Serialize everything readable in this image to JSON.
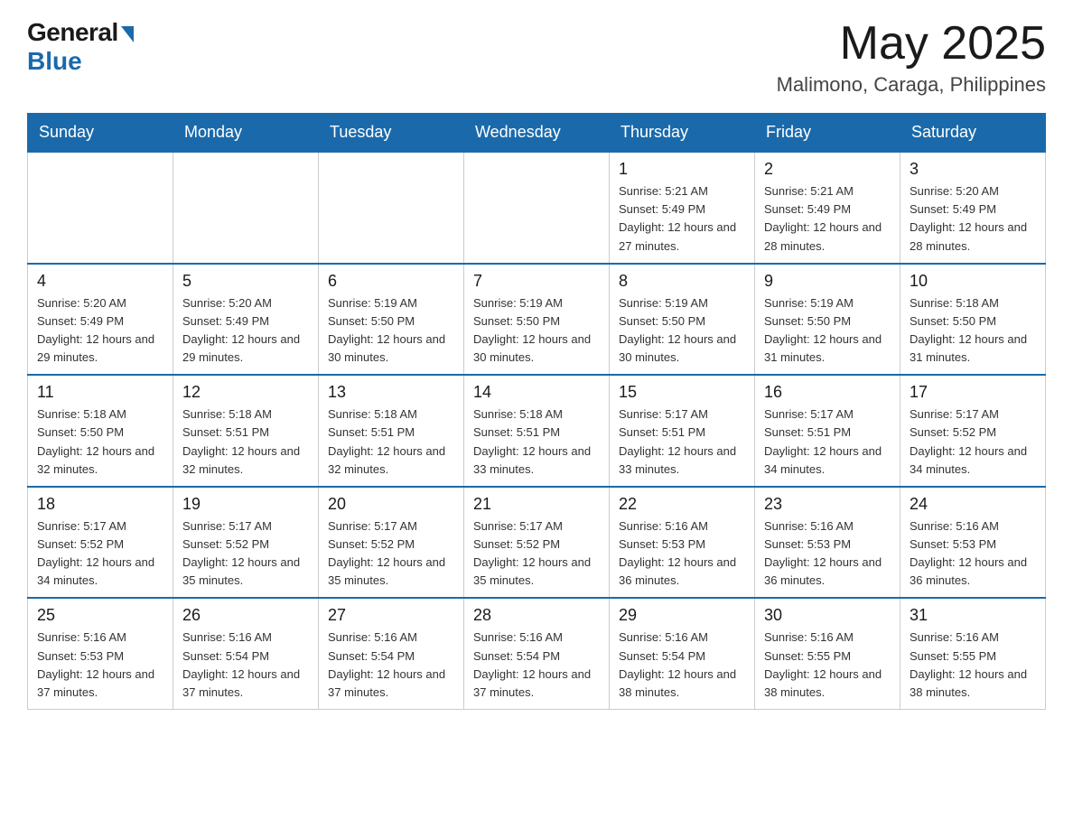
{
  "header": {
    "logo_general": "General",
    "logo_blue": "Blue",
    "month_title": "May 2025",
    "location": "Malimono, Caraga, Philippines"
  },
  "days_of_week": [
    "Sunday",
    "Monday",
    "Tuesday",
    "Wednesday",
    "Thursday",
    "Friday",
    "Saturday"
  ],
  "weeks": [
    [
      {
        "day": "",
        "info": ""
      },
      {
        "day": "",
        "info": ""
      },
      {
        "day": "",
        "info": ""
      },
      {
        "day": "",
        "info": ""
      },
      {
        "day": "1",
        "info": "Sunrise: 5:21 AM\nSunset: 5:49 PM\nDaylight: 12 hours and 27 minutes."
      },
      {
        "day": "2",
        "info": "Sunrise: 5:21 AM\nSunset: 5:49 PM\nDaylight: 12 hours and 28 minutes."
      },
      {
        "day": "3",
        "info": "Sunrise: 5:20 AM\nSunset: 5:49 PM\nDaylight: 12 hours and 28 minutes."
      }
    ],
    [
      {
        "day": "4",
        "info": "Sunrise: 5:20 AM\nSunset: 5:49 PM\nDaylight: 12 hours and 29 minutes."
      },
      {
        "day": "5",
        "info": "Sunrise: 5:20 AM\nSunset: 5:49 PM\nDaylight: 12 hours and 29 minutes."
      },
      {
        "day": "6",
        "info": "Sunrise: 5:19 AM\nSunset: 5:50 PM\nDaylight: 12 hours and 30 minutes."
      },
      {
        "day": "7",
        "info": "Sunrise: 5:19 AM\nSunset: 5:50 PM\nDaylight: 12 hours and 30 minutes."
      },
      {
        "day": "8",
        "info": "Sunrise: 5:19 AM\nSunset: 5:50 PM\nDaylight: 12 hours and 30 minutes."
      },
      {
        "day": "9",
        "info": "Sunrise: 5:19 AM\nSunset: 5:50 PM\nDaylight: 12 hours and 31 minutes."
      },
      {
        "day": "10",
        "info": "Sunrise: 5:18 AM\nSunset: 5:50 PM\nDaylight: 12 hours and 31 minutes."
      }
    ],
    [
      {
        "day": "11",
        "info": "Sunrise: 5:18 AM\nSunset: 5:50 PM\nDaylight: 12 hours and 32 minutes."
      },
      {
        "day": "12",
        "info": "Sunrise: 5:18 AM\nSunset: 5:51 PM\nDaylight: 12 hours and 32 minutes."
      },
      {
        "day": "13",
        "info": "Sunrise: 5:18 AM\nSunset: 5:51 PM\nDaylight: 12 hours and 32 minutes."
      },
      {
        "day": "14",
        "info": "Sunrise: 5:18 AM\nSunset: 5:51 PM\nDaylight: 12 hours and 33 minutes."
      },
      {
        "day": "15",
        "info": "Sunrise: 5:17 AM\nSunset: 5:51 PM\nDaylight: 12 hours and 33 minutes."
      },
      {
        "day": "16",
        "info": "Sunrise: 5:17 AM\nSunset: 5:51 PM\nDaylight: 12 hours and 34 minutes."
      },
      {
        "day": "17",
        "info": "Sunrise: 5:17 AM\nSunset: 5:52 PM\nDaylight: 12 hours and 34 minutes."
      }
    ],
    [
      {
        "day": "18",
        "info": "Sunrise: 5:17 AM\nSunset: 5:52 PM\nDaylight: 12 hours and 34 minutes."
      },
      {
        "day": "19",
        "info": "Sunrise: 5:17 AM\nSunset: 5:52 PM\nDaylight: 12 hours and 35 minutes."
      },
      {
        "day": "20",
        "info": "Sunrise: 5:17 AM\nSunset: 5:52 PM\nDaylight: 12 hours and 35 minutes."
      },
      {
        "day": "21",
        "info": "Sunrise: 5:17 AM\nSunset: 5:52 PM\nDaylight: 12 hours and 35 minutes."
      },
      {
        "day": "22",
        "info": "Sunrise: 5:16 AM\nSunset: 5:53 PM\nDaylight: 12 hours and 36 minutes."
      },
      {
        "day": "23",
        "info": "Sunrise: 5:16 AM\nSunset: 5:53 PM\nDaylight: 12 hours and 36 minutes."
      },
      {
        "day": "24",
        "info": "Sunrise: 5:16 AM\nSunset: 5:53 PM\nDaylight: 12 hours and 36 minutes."
      }
    ],
    [
      {
        "day": "25",
        "info": "Sunrise: 5:16 AM\nSunset: 5:53 PM\nDaylight: 12 hours and 37 minutes."
      },
      {
        "day": "26",
        "info": "Sunrise: 5:16 AM\nSunset: 5:54 PM\nDaylight: 12 hours and 37 minutes."
      },
      {
        "day": "27",
        "info": "Sunrise: 5:16 AM\nSunset: 5:54 PM\nDaylight: 12 hours and 37 minutes."
      },
      {
        "day": "28",
        "info": "Sunrise: 5:16 AM\nSunset: 5:54 PM\nDaylight: 12 hours and 37 minutes."
      },
      {
        "day": "29",
        "info": "Sunrise: 5:16 AM\nSunset: 5:54 PM\nDaylight: 12 hours and 38 minutes."
      },
      {
        "day": "30",
        "info": "Sunrise: 5:16 AM\nSunset: 5:55 PM\nDaylight: 12 hours and 38 minutes."
      },
      {
        "day": "31",
        "info": "Sunrise: 5:16 AM\nSunset: 5:55 PM\nDaylight: 12 hours and 38 minutes."
      }
    ]
  ]
}
